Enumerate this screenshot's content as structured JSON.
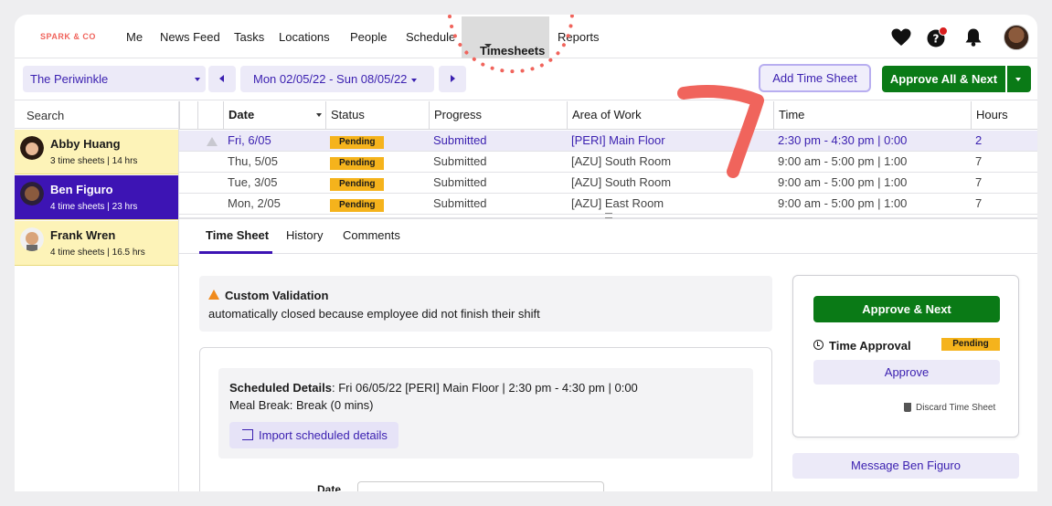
{
  "brand": {
    "logo_text": "SPARK & CO",
    "accent": "#3d14b4",
    "green": "#0a7a16",
    "pending": "#f5b31c"
  },
  "nav": {
    "items": [
      "Me",
      "News Feed",
      "Tasks",
      "Locations",
      "People",
      "Schedule",
      "Timesheets",
      "Reports"
    ],
    "active": "Timesheets",
    "icons": [
      "heart-icon",
      "help-icon",
      "bell-icon",
      "user-avatar"
    ]
  },
  "toolbar": {
    "location": "The Periwinkle",
    "date_range": "Mon 02/05/22 - Sun 08/05/22",
    "add_time_sheet": "Add Time Sheet",
    "approve_all_next": "Approve All & Next"
  },
  "sidebar": {
    "search_placeholder": "Search",
    "people": [
      {
        "name": "Abby Huang",
        "meta": "3 time sheets | 14 hrs"
      },
      {
        "name": "Ben Figuro",
        "meta": "4 time sheets | 23 hrs"
      },
      {
        "name": "Frank Wren",
        "meta": "4 time sheets | 16.5 hrs"
      }
    ]
  },
  "table": {
    "headers": [
      "Date",
      "Status",
      "Progress",
      "Area of Work",
      "Time",
      "Hours"
    ],
    "rows": [
      {
        "date": "Fri, 6/05",
        "status": "Pending",
        "progress": "Submitted",
        "area": "[PERI] Main Floor",
        "time": "2:30 pm - 4:30 pm | 0:00",
        "hours": "2"
      },
      {
        "date": "Thu, 5/05",
        "status": "Pending",
        "progress": "Submitted",
        "area": "[AZU] South Room",
        "time": "9:00 am - 5:00 pm | 1:00",
        "hours": "7"
      },
      {
        "date": "Tue, 3/05",
        "status": "Pending",
        "progress": "Submitted",
        "area": "[AZU] South Room",
        "time": "9:00 am - 5:00 pm | 1:00",
        "hours": "7"
      },
      {
        "date": "Mon, 2/05",
        "status": "Pending",
        "progress": "Submitted",
        "area": "[AZU] East Room",
        "time": "9:00 am - 5:00 pm | 1:00",
        "hours": "7"
      }
    ]
  },
  "tabs": [
    "Time Sheet",
    "History",
    "Comments"
  ],
  "validation": {
    "title": "Custom Validation",
    "description": "automatically closed because employee did not finish their shift"
  },
  "scheduled": {
    "label": "Scheduled Details",
    "value": ": Fri 06/05/22 [PERI] Main Floor | 2:30 pm - 4:30 pm | 0:00",
    "meal_break": "Meal Break: Break (0 mins)",
    "import_button": "Import scheduled details",
    "date_label": "Date"
  },
  "approval": {
    "approve_next": "Approve & Next",
    "time_approval": "Time Approval",
    "status": "Pending",
    "approve": "Approve",
    "discard": "Discard Time Sheet",
    "message": "Message Ben Figuro"
  }
}
